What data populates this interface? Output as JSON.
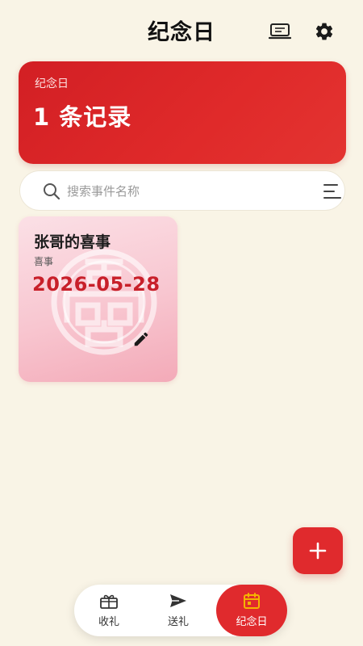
{
  "header": {
    "title": "纪念日",
    "icons": [
      "monitor-icon",
      "gear-icon"
    ]
  },
  "summary": {
    "label": "纪念日",
    "count_text": "1 条记录"
  },
  "search": {
    "placeholder": "搜索事件名称",
    "value": ""
  },
  "events": [
    {
      "title": "张哥的喜事",
      "type": "喜事",
      "date": "2026-05-28",
      "emblem": "double-happiness-icon"
    }
  ],
  "fab": {
    "icon": "plus-icon"
  },
  "nav": {
    "items": [
      {
        "label": "收礼",
        "icon": "gift-box-icon",
        "active": false
      },
      {
        "label": "送礼",
        "icon": "send-icon",
        "active": false
      },
      {
        "label": "纪念日",
        "icon": "calendar-icon",
        "active": true
      }
    ]
  },
  "colors": {
    "accent": "#e02a2d",
    "background": "#f9f4e6",
    "card_pink": "#f8c6d0",
    "date_red": "#c8202a",
    "calendar_icon": "#f5b400"
  }
}
